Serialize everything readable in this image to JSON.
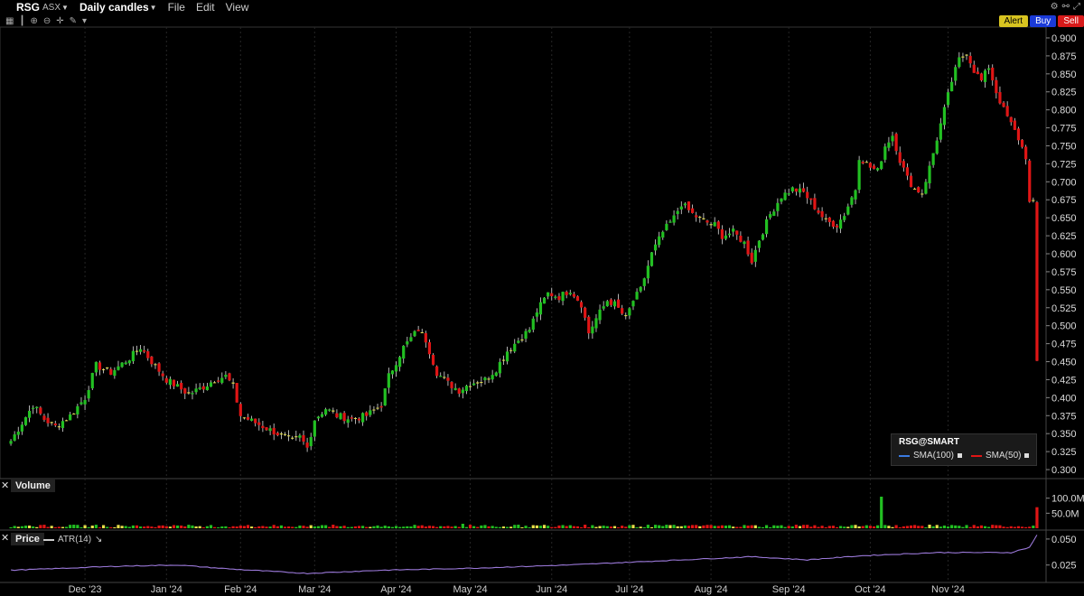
{
  "header": {
    "symbol": "RSG",
    "exchange": "ASX",
    "chart_type": "Daily candles",
    "menus": [
      "File",
      "Edit",
      "View"
    ],
    "buttons": {
      "alert": "Alert",
      "buy": "Buy",
      "sell": "Sell"
    }
  },
  "panels": {
    "volume_title": "Volume",
    "price_title": "Price",
    "atr_label": "ATR(14)"
  },
  "legend": {
    "title": "RSG@SMART",
    "sma100": "SMA(100)",
    "sma50": "SMA(50)"
  },
  "colors": {
    "up": "#22c022",
    "down": "#e01515",
    "neutral": "#e8e04a",
    "atr": "#9a78d8"
  },
  "chart_data": {
    "type": "candlestick",
    "x_labels": [
      "Dec '23",
      "Jan '24",
      "Feb '24",
      "Mar '24",
      "Apr '24",
      "May '24",
      "Jun '24",
      "Jul '24",
      "Aug '24",
      "Sep '24",
      "Oct '24",
      "Nov '24"
    ],
    "x_label_days": [
      20,
      42,
      62,
      82,
      104,
      124,
      146,
      167,
      189,
      210,
      232,
      253
    ],
    "price_axis": {
      "range": [
        0.29,
        0.91
      ],
      "ticks": [
        0.3,
        0.325,
        0.35,
        0.375,
        0.4,
        0.425,
        0.45,
        0.475,
        0.5,
        0.525,
        0.55,
        0.575,
        0.6,
        0.625,
        0.65,
        0.675,
        0.7,
        0.725,
        0.75,
        0.775,
        0.8,
        0.825,
        0.85,
        0.875,
        0.9
      ]
    },
    "volume_axis": {
      "range": [
        0,
        120
      ],
      "ticks": [
        "50.0M",
        "100.0M"
      ],
      "tick_values": [
        50,
        100
      ]
    },
    "atr_axis": {
      "range": [
        0.01,
        0.056
      ],
      "ticks": [
        "0.025",
        "0.050"
      ],
      "tick_values": [
        0.025,
        0.05
      ]
    },
    "close_anchors": [
      [
        0,
        0.34
      ],
      [
        3,
        0.365
      ],
      [
        6,
        0.39
      ],
      [
        9,
        0.37
      ],
      [
        12,
        0.36
      ],
      [
        16,
        0.375
      ],
      [
        20,
        0.4
      ],
      [
        23,
        0.445
      ],
      [
        27,
        0.435
      ],
      [
        32,
        0.455
      ],
      [
        35,
        0.47
      ],
      [
        38,
        0.45
      ],
      [
        42,
        0.425
      ],
      [
        45,
        0.415
      ],
      [
        48,
        0.405
      ],
      [
        52,
        0.415
      ],
      [
        55,
        0.425
      ],
      [
        58,
        0.43
      ],
      [
        60,
        0.415
      ],
      [
        62,
        0.375
      ],
      [
        66,
        0.365
      ],
      [
        70,
        0.355
      ],
      [
        74,
        0.345
      ],
      [
        76,
        0.34
      ],
      [
        78,
        0.345
      ],
      [
        80,
        0.33
      ],
      [
        82,
        0.37
      ],
      [
        85,
        0.385
      ],
      [
        88,
        0.375
      ],
      [
        92,
        0.37
      ],
      [
        96,
        0.375
      ],
      [
        100,
        0.39
      ],
      [
        102,
        0.43
      ],
      [
        106,
        0.47
      ],
      [
        110,
        0.495
      ],
      [
        112,
        0.48
      ],
      [
        115,
        0.435
      ],
      [
        118,
        0.42
      ],
      [
        121,
        0.41
      ],
      [
        124,
        0.42
      ],
      [
        128,
        0.425
      ],
      [
        131,
        0.44
      ],
      [
        134,
        0.465
      ],
      [
        137,
        0.48
      ],
      [
        140,
        0.495
      ],
      [
        142,
        0.52
      ],
      [
        145,
        0.545
      ],
      [
        148,
        0.54
      ],
      [
        151,
        0.55
      ],
      [
        154,
        0.53
      ],
      [
        156,
        0.49
      ],
      [
        158,
        0.51
      ],
      [
        161,
        0.535
      ],
      [
        163,
        0.53
      ],
      [
        166,
        0.51
      ],
      [
        168,
        0.535
      ],
      [
        170,
        0.55
      ],
      [
        173,
        0.6
      ],
      [
        176,
        0.63
      ],
      [
        179,
        0.65
      ],
      [
        181,
        0.67
      ],
      [
        184,
        0.655
      ],
      [
        187,
        0.645
      ],
      [
        190,
        0.64
      ],
      [
        192,
        0.625
      ],
      [
        195,
        0.63
      ],
      [
        198,
        0.615
      ],
      [
        200,
        0.59
      ],
      [
        202,
        0.62
      ],
      [
        205,
        0.655
      ],
      [
        208,
        0.68
      ],
      [
        211,
        0.69
      ],
      [
        214,
        0.685
      ],
      [
        217,
        0.665
      ],
      [
        220,
        0.645
      ],
      [
        223,
        0.64
      ],
      [
        225,
        0.655
      ],
      [
        228,
        0.69
      ],
      [
        229,
        0.735
      ],
      [
        232,
        0.72
      ],
      [
        234,
        0.715
      ],
      [
        236,
        0.75
      ],
      [
        238,
        0.765
      ],
      [
        240,
        0.73
      ],
      [
        242,
        0.705
      ],
      [
        244,
        0.69
      ],
      [
        246,
        0.685
      ],
      [
        248,
        0.72
      ],
      [
        250,
        0.76
      ],
      [
        252,
        0.8
      ],
      [
        254,
        0.84
      ],
      [
        256,
        0.87
      ],
      [
        258,
        0.88
      ],
      [
        260,
        0.855
      ],
      [
        262,
        0.84
      ],
      [
        264,
        0.86
      ],
      [
        266,
        0.825
      ],
      [
        268,
        0.8
      ],
      [
        270,
        0.78
      ],
      [
        272,
        0.76
      ],
      [
        274,
        0.735
      ],
      [
        275,
        0.67
      ],
      [
        276,
        0.67
      ],
      [
        277,
        0.45
      ]
    ],
    "volume_spikes": [
      [
        122,
        15
      ],
      [
        235,
        105
      ],
      [
        277,
        70
      ]
    ],
    "atr_anchors": [
      [
        0,
        0.02
      ],
      [
        30,
        0.024
      ],
      [
        45,
        0.025
      ],
      [
        60,
        0.021
      ],
      [
        80,
        0.017
      ],
      [
        100,
        0.02
      ],
      [
        125,
        0.022
      ],
      [
        150,
        0.025
      ],
      [
        175,
        0.029
      ],
      [
        200,
        0.033
      ],
      [
        215,
        0.03
      ],
      [
        230,
        0.034
      ],
      [
        250,
        0.037
      ],
      [
        270,
        0.037
      ],
      [
        275,
        0.042
      ],
      [
        277,
        0.054
      ]
    ]
  }
}
